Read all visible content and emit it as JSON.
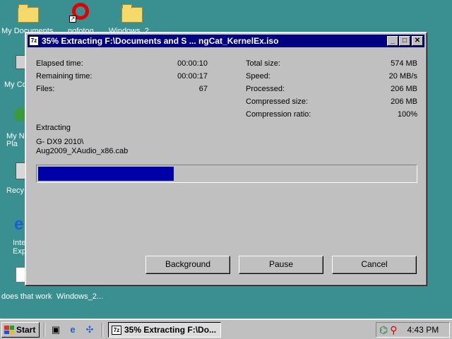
{
  "desktop": {
    "icons": [
      {
        "label": "My Documents",
        "icon": "folder-documents-icon"
      },
      {
        "label": "nofotog",
        "icon": "shortcut-icon"
      },
      {
        "label": "Windows_2",
        "icon": "folder-icon"
      },
      {
        "label": "My Co",
        "icon": "computer-icon"
      },
      {
        "label": "My N Pla",
        "icon": "network-icon"
      },
      {
        "label": "Recy",
        "icon": "recycle-bin-icon"
      },
      {
        "label": "Inte Exp",
        "icon": "ie-icon"
      },
      {
        "label": "does that work",
        "icon": "shortcut-icon"
      },
      {
        "label": "Windows_2...",
        "icon": "shortcut-icon"
      }
    ]
  },
  "window": {
    "app_icon": "7z",
    "title": "35% Extracting F:\\Documents and S ... ngCat_KernelEx.iso",
    "left_stats": [
      {
        "label": "Elapsed time:",
        "value": "00:00:10"
      },
      {
        "label": "Remaining time:",
        "value": "00:00:17"
      },
      {
        "label": "Files:",
        "value": "67"
      }
    ],
    "right_stats": [
      {
        "label": "Total size:",
        "value": "574 MB"
      },
      {
        "label": "Speed:",
        "value": "20 MB/s"
      },
      {
        "label": "Processed:",
        "value": "206 MB"
      },
      {
        "label": "Compressed size:",
        "value": "206 MB"
      },
      {
        "label": "Compression ratio:",
        "value": "100%"
      }
    ],
    "status_heading": "Extracting",
    "current_path_line1": "G- DX9 2010\\",
    "current_path_line2": "Aug2009_XAudio_x86.cab",
    "progress_percent": 36,
    "progress_color": "#0000a8",
    "buttons": {
      "background": "Background",
      "pause": "Pause",
      "cancel": "Cancel"
    }
  },
  "taskbar": {
    "start_label": "Start",
    "task_label": "35% Extracting F:\\Do...",
    "task_icon": "7z",
    "clock": "4:43 PM"
  }
}
